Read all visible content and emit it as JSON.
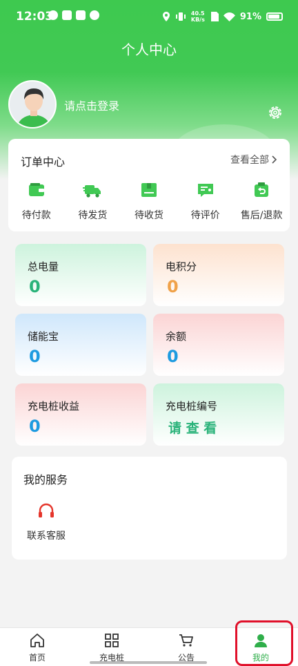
{
  "status_bar": {
    "time": "12:03",
    "net_speed": "40.5 KB/s",
    "battery": "91%"
  },
  "header": {
    "title": "个人中心",
    "login_prompt": "请点击登录"
  },
  "orders": {
    "title": "订单中心",
    "view_all": "查看全部",
    "items": [
      {
        "label": "待付款",
        "icon": "wallet-icon"
      },
      {
        "label": "待发货",
        "icon": "delivery-truck-icon"
      },
      {
        "label": "待收货",
        "icon": "package-icon"
      },
      {
        "label": "待评价",
        "icon": "review-icon"
      },
      {
        "label": "售后/退款",
        "icon": "refund-icon"
      }
    ]
  },
  "stats": [
    {
      "label": "总电量",
      "value": "0"
    },
    {
      "label": "电积分",
      "value": "0"
    },
    {
      "label": "储能宝",
      "value": "0"
    },
    {
      "label": "余额",
      "value": "0"
    },
    {
      "label": "充电桩收益",
      "value": "0"
    },
    {
      "label": "充电桩编号",
      "value": "请 查 看"
    }
  ],
  "services": {
    "title": "我的服务",
    "items": [
      {
        "label": "联系客服",
        "icon": "headset-icon"
      }
    ]
  },
  "tabbar": [
    {
      "label": "首页",
      "icon": "home-icon"
    },
    {
      "label": "充电桩",
      "icon": "grid-icon"
    },
    {
      "label": "公告",
      "icon": "cart-icon"
    },
    {
      "label": "我的",
      "icon": "user-icon",
      "active": true
    }
  ],
  "colors": {
    "brand_green": "#3ec94f",
    "value_green": "#2ab37a",
    "value_orange": "#f0a24a",
    "value_blue": "#1e9be0",
    "highlight_red": "#e0102a"
  }
}
